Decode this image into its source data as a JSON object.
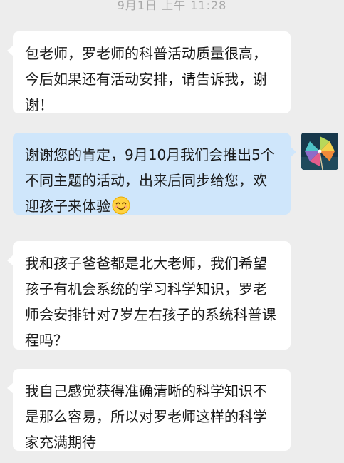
{
  "chat": {
    "timestamp": "9月1日 上午 11:28",
    "messages": [
      {
        "side": "left",
        "text": "包老师，罗老师的科普活动质量很高，今后如果还有活动安排，请告诉我，谢谢！"
      },
      {
        "side": "right",
        "text": "谢谢您的肯定，9月10月我们会推出5个不同主题的活动，出来后同步给您，欢迎孩子来体验",
        "emoji": "smiling-face-emoji"
      },
      {
        "side": "left",
        "text": "我和孩子爸爸都是北大老师，我们希望孩子有机会系统的学习科学知识，罗老师会安排针对7岁左右孩子的系统科普课程吗？"
      },
      {
        "side": "left",
        "text": "我自己感觉获得准确清晰的科学知识不是那么容易，所以对罗老师这样的科学家充满期待"
      }
    ]
  },
  "colors": {
    "background": "#ededed",
    "incoming_bubble": "#ffffff",
    "outgoing_bubble": "#cfe6fb",
    "timestamp_text": "#a8a8a8",
    "message_text": "#191919"
  },
  "icons": {
    "avatar": "pinwheel-avatar-icon",
    "emoji": "smiling-face-emoji"
  }
}
